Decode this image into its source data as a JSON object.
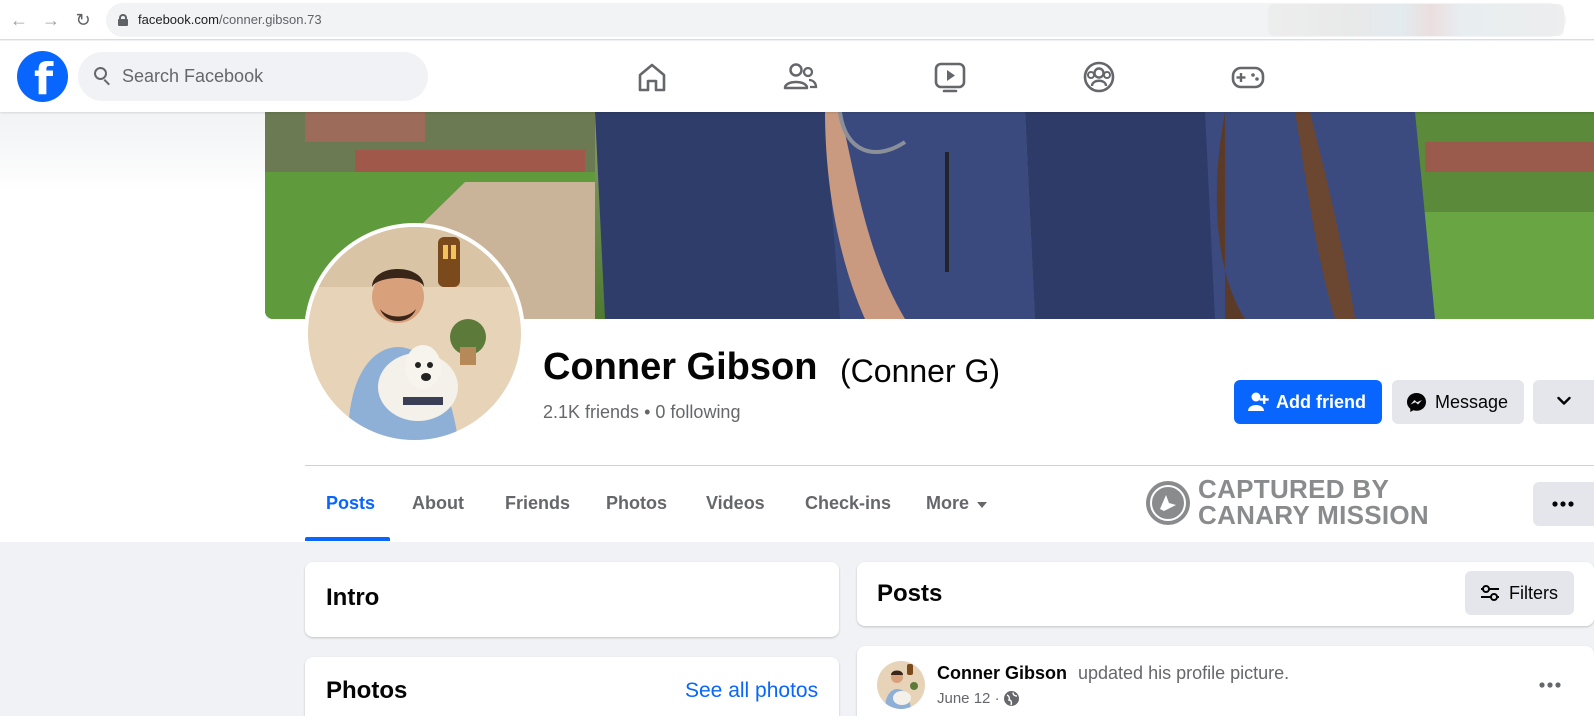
{
  "browser": {
    "url_domain": "facebook.com",
    "url_path": "/conner.gibson.73"
  },
  "header": {
    "logo_letter": "f",
    "search_placeholder": "Search Facebook",
    "nav_icons": [
      "home-icon",
      "friends-icon",
      "watch-icon",
      "groups-icon",
      "gaming-icon"
    ]
  },
  "profile": {
    "name": "Conner Gibson",
    "alternate_name": "(Conner G)",
    "friends_count": "2.1K friends",
    "following_count": "0 following",
    "separator": "•",
    "add_friend_label": "Add friend",
    "message_label": "Message"
  },
  "tabs": [
    {
      "label": "Posts",
      "active": true
    },
    {
      "label": "About"
    },
    {
      "label": "Friends"
    },
    {
      "label": "Photos"
    },
    {
      "label": "Videos"
    },
    {
      "label": "Check-ins"
    },
    {
      "label": "More"
    }
  ],
  "watermark": {
    "line1": "CAPTURED BY",
    "line2": "CANARY MISSION"
  },
  "intro": {
    "title": "Intro"
  },
  "photos": {
    "title": "Photos",
    "see_all": "See all photos"
  },
  "posts": {
    "title": "Posts",
    "filters_label": "Filters",
    "items": [
      {
        "author": "Conner Gibson",
        "action": "updated his profile picture.",
        "date": "June 12",
        "date_sep": "·"
      }
    ]
  },
  "colors": {
    "brand": "#0866ff",
    "secondary_button": "#e4e6eb",
    "muted_text": "#65676b",
    "page_bg": "#f0f2f5"
  }
}
